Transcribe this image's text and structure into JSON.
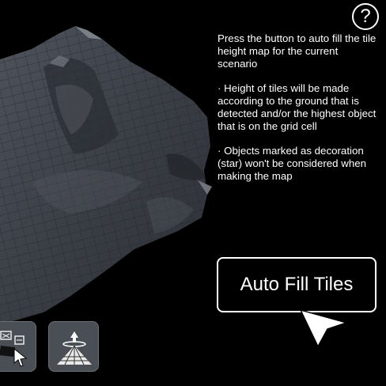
{
  "help": {
    "glyph": "?",
    "icon": "question-icon"
  },
  "info": {
    "line1": "Press the button to auto fill the tile height map for the current scenario",
    "line2": "· Height of tiles will be made according to the ground that is detected and/or the highest object that is on the grid cell",
    "line3": "· Objects marked as decoration (star) won't be considered when making the map"
  },
  "button": {
    "label": "Auto Fill Tiles"
  },
  "toolbar": {
    "tools": [
      {
        "icon": "select-objects-icon"
      },
      {
        "icon": "height-map-icon"
      }
    ]
  },
  "colors": {
    "background": "#000000",
    "terrain": "#3b3f46",
    "text": "#ffffff"
  }
}
